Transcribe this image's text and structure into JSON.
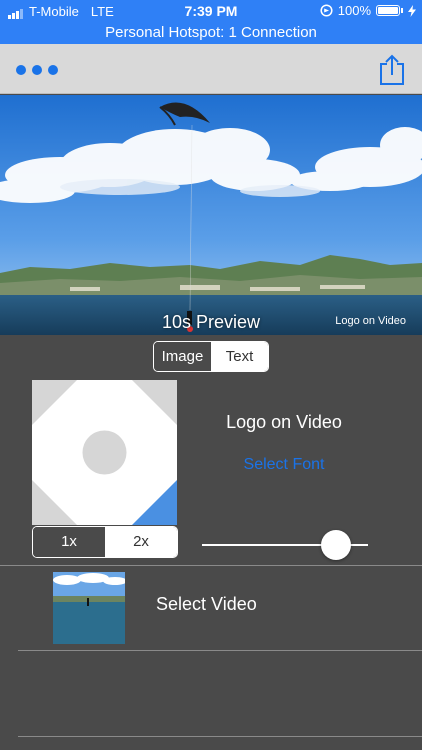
{
  "status_bar": {
    "carrier": "T-Mobile",
    "network": "LTE",
    "time": "7:39 PM",
    "battery": "100%"
  },
  "hotspot": {
    "text": "Personal Hotspot: 1 Connection"
  },
  "preview": {
    "label": "10s Preview",
    "watermark": "Logo on Video"
  },
  "mode_toggle": {
    "options": [
      "Image",
      "Text"
    ],
    "selected": "Text"
  },
  "logo_text": {
    "text": "Logo on Video",
    "select_font": "Select Font"
  },
  "scale_toggle": {
    "options": [
      "1x",
      "2x"
    ],
    "selected": "1x"
  },
  "size_slider": {
    "value": 0.81
  },
  "video": {
    "select_label": "Select Video"
  },
  "colors": {
    "accent": "#1a73e8",
    "status_bar": "#2f80f6",
    "panel": "#4a4a4a",
    "nav": "#d9d9d9"
  },
  "icons": [
    "more-icon",
    "share-icon",
    "location-lock-icon",
    "charging-icon",
    "battery-icon",
    "signal-icon"
  ]
}
